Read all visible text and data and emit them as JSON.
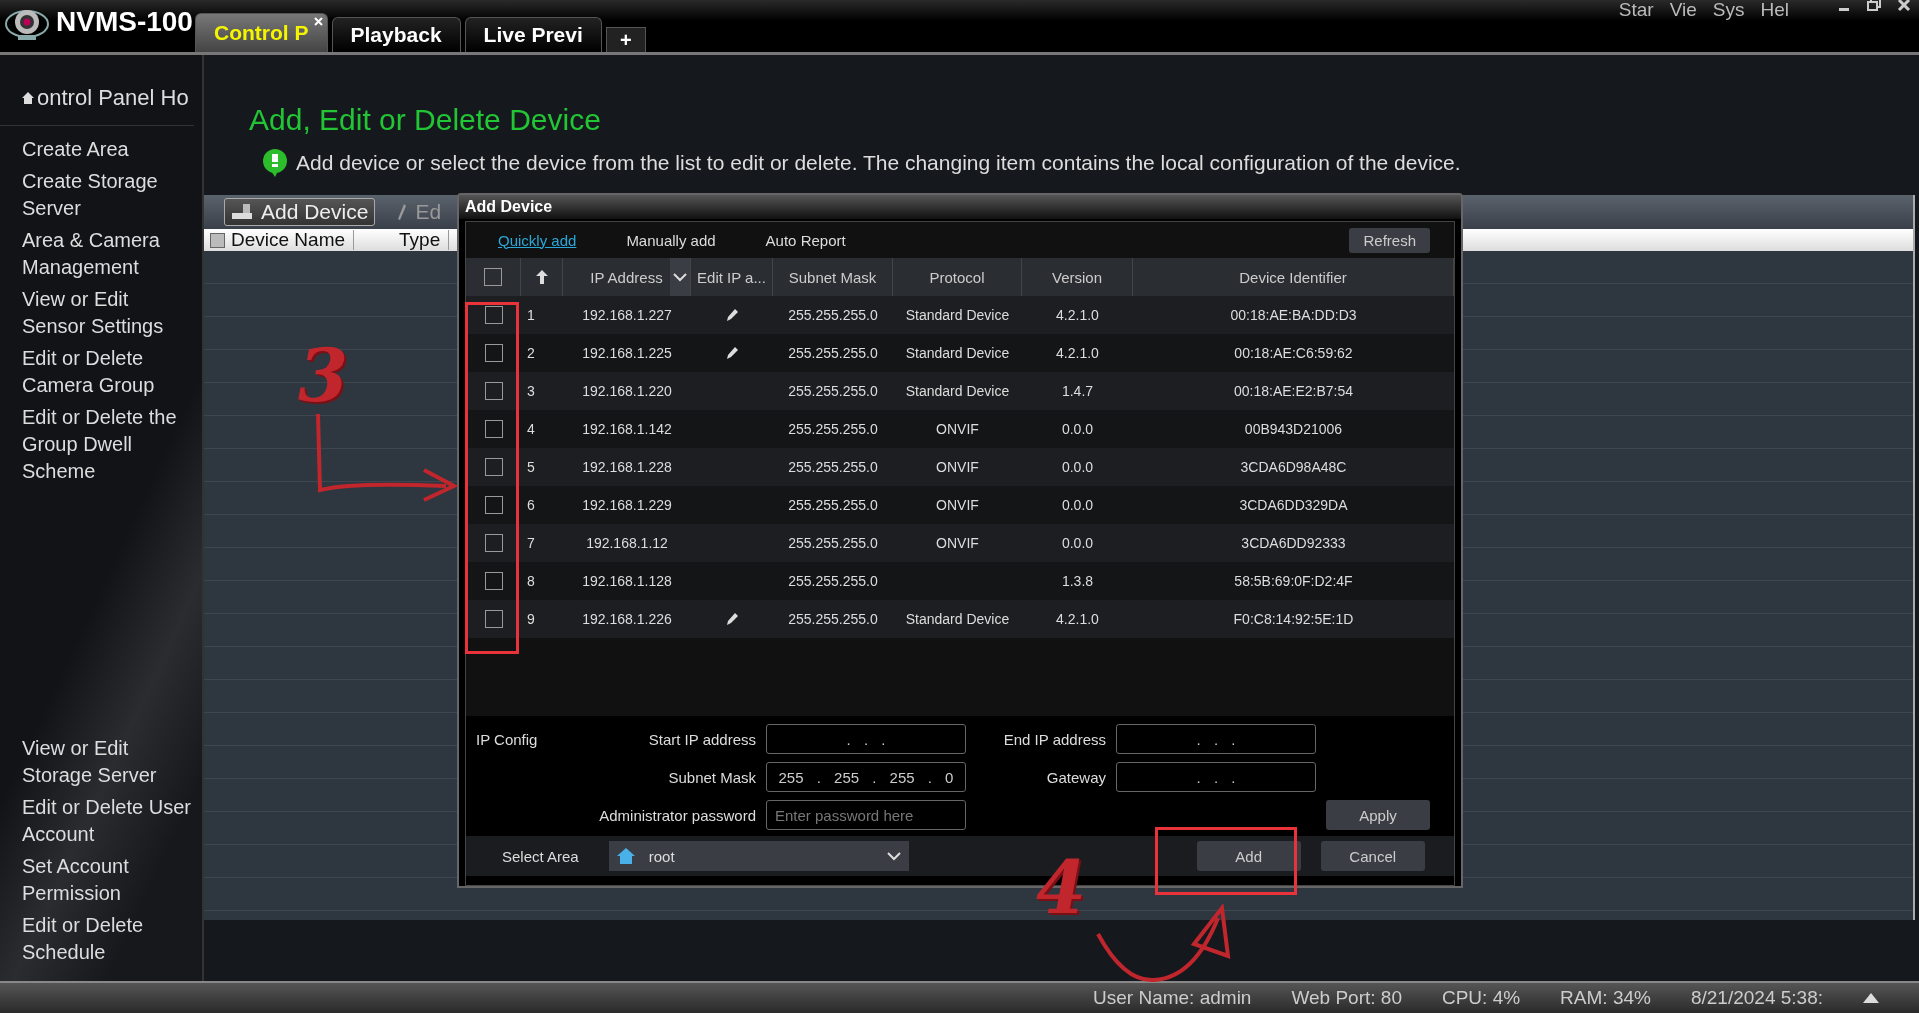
{
  "window": {
    "title": "NVMS-100",
    "menu": [
      "Star",
      "Vie",
      "Sys",
      "Hel"
    ]
  },
  "tabs": [
    {
      "label": "Control P",
      "selected": true,
      "closable": true
    },
    {
      "label": "Playback",
      "selected": false,
      "closable": false
    },
    {
      "label": "Live Previ",
      "selected": false,
      "closable": false
    }
  ],
  "new_tab": "+",
  "sidebar": {
    "home": "ontrol Panel Ho",
    "groups": [
      [
        "Create Area",
        "Create Storage Server",
        "Area & Camera Management",
        "View or Edit Sensor Settings",
        "Edit or Delete Camera Group",
        "Edit or Delete the Group Dwell Scheme"
      ],
      [
        "View or Edit Storage Server",
        "Edit or Delete User Account",
        "Set Account Permission",
        "Edit or Delete Schedule"
      ]
    ]
  },
  "page": {
    "heading": "Add, Edit or Delete Device",
    "info": "Add device or select the device from the list to edit or delete. The changing item contains the local configuration of the device."
  },
  "toolbar": {
    "add": "Add Device",
    "edit": "Ed"
  },
  "table": {
    "columns": [
      "Device Name",
      "Type"
    ],
    "header_checked": false
  },
  "dialog": {
    "title": "Add Device",
    "tabs": [
      {
        "label": "Quickly add",
        "selected": true
      },
      {
        "label": "Manually add",
        "selected": false
      },
      {
        "label": "Auto Report",
        "selected": false
      }
    ],
    "refresh": "Refresh",
    "header_checked": false,
    "columns": [
      "IP Address",
      "Edit IP a...",
      "Subnet Mask",
      "Protocol",
      "Version",
      "Device Identifier"
    ],
    "rows": [
      {
        "checked": false,
        "no": "1",
        "ip": "192.168.1.227",
        "editable": true,
        "mask": "255.255.255.0",
        "protocol": "Standard Device",
        "version": "4.2.1.0",
        "id": "00:18:AE:BA:DD:D3"
      },
      {
        "checked": false,
        "no": "2",
        "ip": "192.168.1.225",
        "editable": true,
        "mask": "255.255.255.0",
        "protocol": "Standard Device",
        "version": "4.2.1.0",
        "id": "00:18:AE:C6:59:62"
      },
      {
        "checked": false,
        "no": "3",
        "ip": "192.168.1.220",
        "editable": false,
        "mask": "255.255.255.0",
        "protocol": "Standard Device",
        "version": "1.4.7",
        "id": "00:18:AE:E2:B7:54"
      },
      {
        "checked": false,
        "no": "4",
        "ip": "192.168.1.142",
        "editable": false,
        "mask": "255.255.255.0",
        "protocol": "ONVIF",
        "version": "0.0.0",
        "id": "00B943D21006"
      },
      {
        "checked": false,
        "no": "5",
        "ip": "192.168.1.228",
        "editable": false,
        "mask": "255.255.255.0",
        "protocol": "ONVIF",
        "version": "0.0.0",
        "id": "3CDA6D98A48C"
      },
      {
        "checked": false,
        "no": "6",
        "ip": "192.168.1.229",
        "editable": false,
        "mask": "255.255.255.0",
        "protocol": "ONVIF",
        "version": "0.0.0",
        "id": "3CDA6DD329DA"
      },
      {
        "checked": false,
        "no": "7",
        "ip": "192.168.1.12",
        "editable": false,
        "mask": "255.255.255.0",
        "protocol": "ONVIF",
        "version": "0.0.0",
        "id": "3CDA6DD92333"
      },
      {
        "checked": false,
        "no": "8",
        "ip": "192.168.1.128",
        "editable": false,
        "mask": "255.255.255.0",
        "version": "1.3.8",
        "id": "58:5B:69:0F:D2:4F"
      },
      {
        "checked": false,
        "no": "9",
        "ip": "192.168.1.226",
        "editable": true,
        "mask": "255.255.255.0",
        "protocol": "Standard Device",
        "version": "4.2.1.0",
        "id": "F0:C8:14:92:5E:1D"
      }
    ],
    "ip_config": {
      "label": "IP Config",
      "start_label": "Start IP address",
      "start_value": ". . .",
      "end_label": "End IP address",
      "end_value": ". . .",
      "mask_label": "Subnet Mask",
      "mask_value": "255 . 255 . 255 . 0",
      "gateway_label": "Gateway",
      "gateway_value": ". . .",
      "password_label": "Administrator password",
      "password_placeholder": "Enter password here",
      "apply": "Apply"
    },
    "area_label": "Select Area",
    "area_value": "root",
    "add": "Add",
    "cancel": "Cancel"
  },
  "annotations": [
    {
      "label": "3"
    },
    {
      "label": "4"
    }
  ],
  "status_bar": [
    "User Name: admin",
    "Web Port: 80",
    "CPU: 4%",
    "RAM: 34%",
    "8/21/2024 5:38:"
  ]
}
